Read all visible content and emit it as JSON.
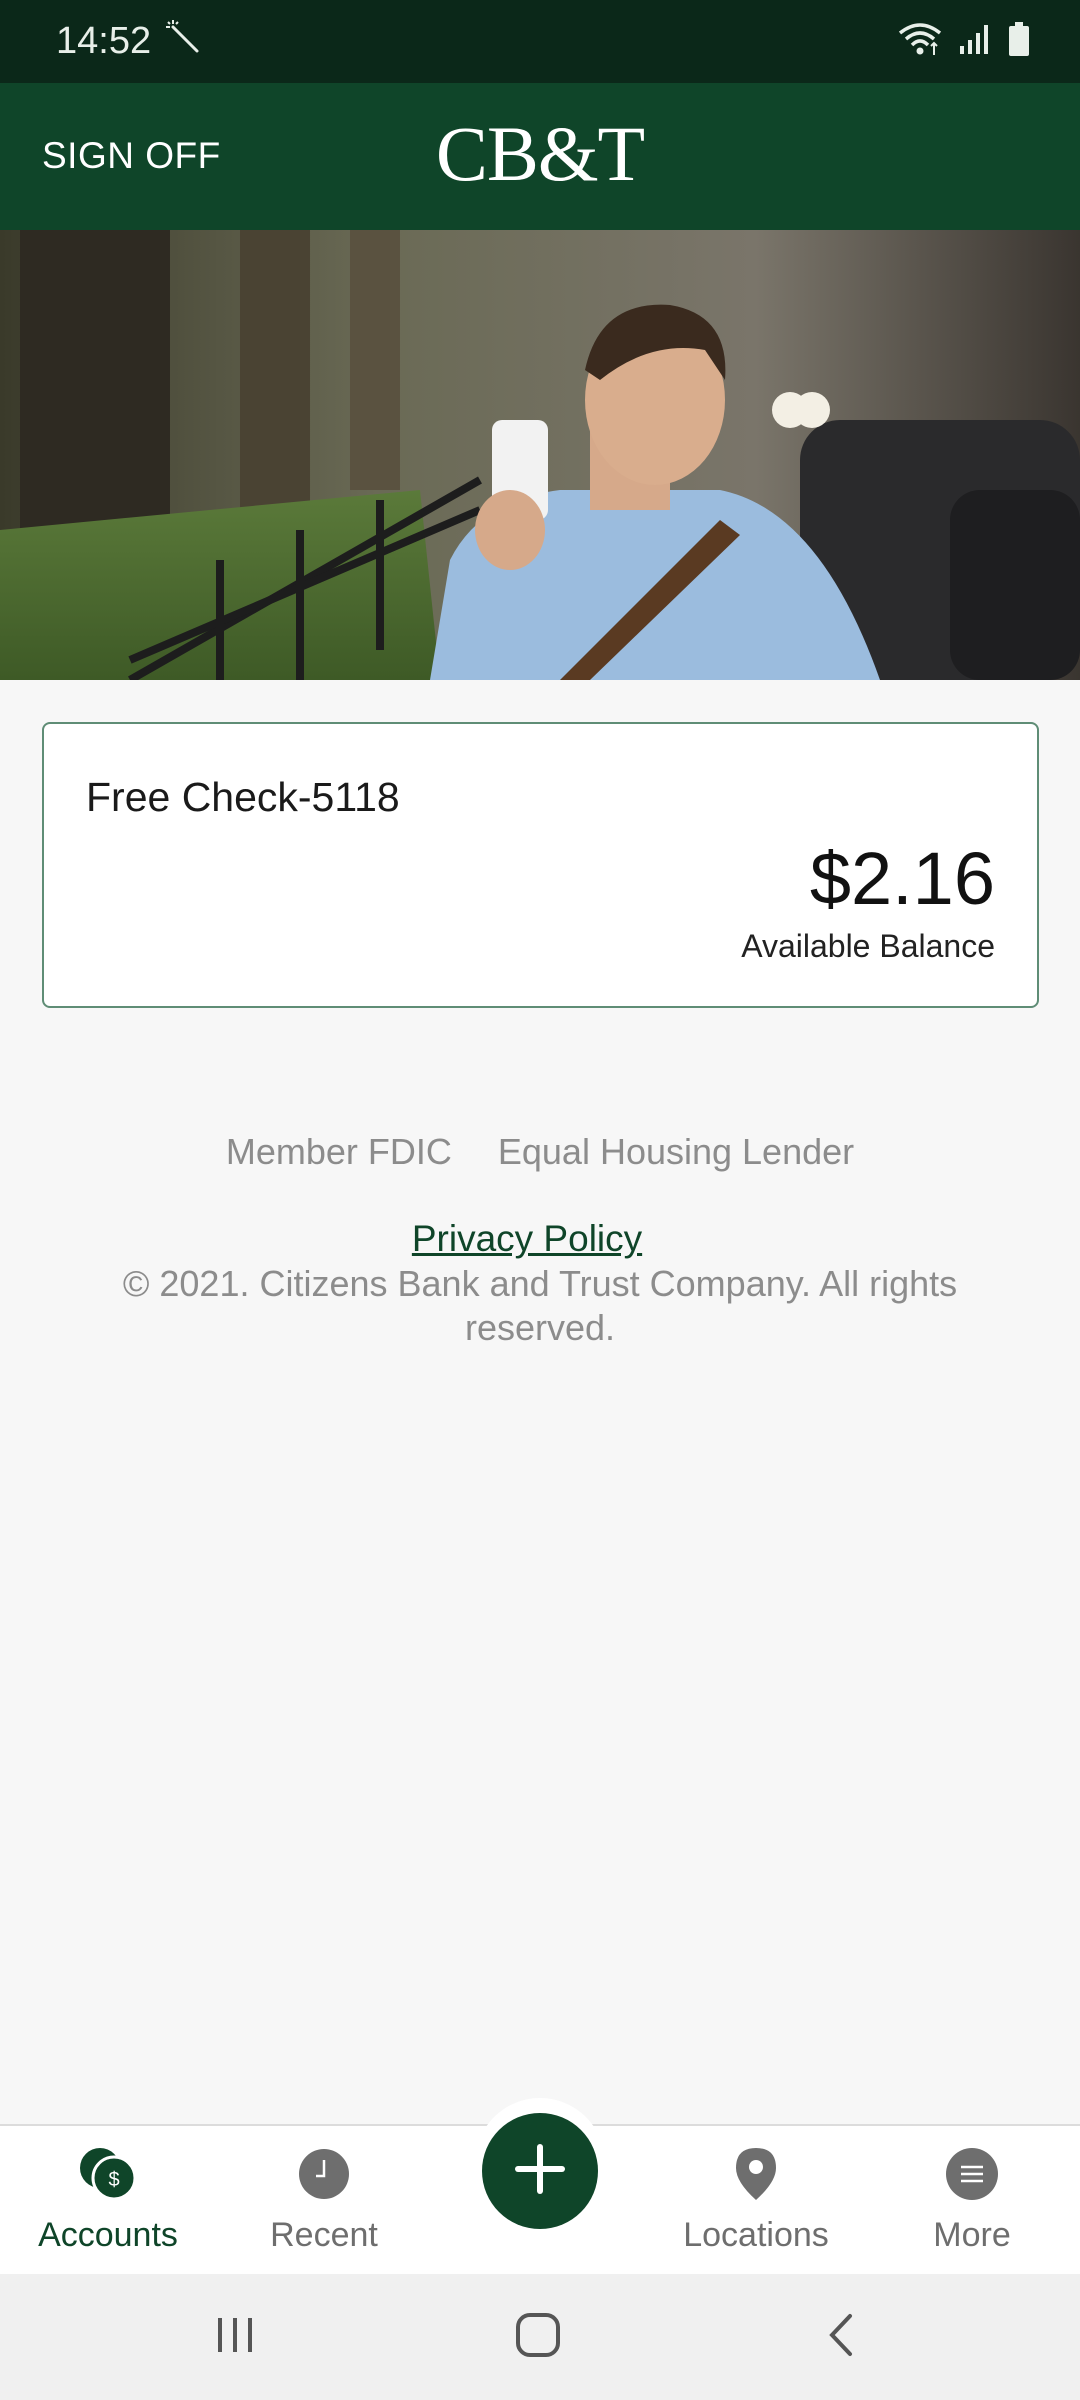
{
  "status_bar": {
    "time": "14:52",
    "icons": [
      "magic-wand-icon",
      "wifi-icon",
      "signal-icon",
      "battery-icon"
    ]
  },
  "header": {
    "sign_off_label": "SIGN OFF",
    "logo_text": "CB&T",
    "background_color": "#0f4529"
  },
  "account": {
    "name": "Free Check-5118",
    "balance": "$2.16",
    "balance_label": "Available Balance"
  },
  "footer": {
    "member_fdic": "Member FDIC",
    "equal_housing": "Equal Housing Lender",
    "privacy_policy": "Privacy Policy",
    "copyright": "© 2021. Citizens Bank and Trust Company. All rights reserved."
  },
  "bottom_nav": {
    "items": [
      {
        "label": "Accounts",
        "icon": "accounts-icon",
        "active": true
      },
      {
        "label": "Recent",
        "icon": "clock-icon",
        "active": false
      },
      {
        "label": "Locations",
        "icon": "location-pin-icon",
        "active": false
      },
      {
        "label": "More",
        "icon": "menu-icon",
        "active": false
      }
    ],
    "fab_icon": "plus-icon"
  },
  "system_nav": {
    "icons": [
      "recent-apps-icon",
      "home-icon",
      "back-icon"
    ]
  },
  "colors": {
    "brand_green": "#0f4529",
    "status_bar": "#0b2819",
    "card_border": "#5f8d76"
  }
}
